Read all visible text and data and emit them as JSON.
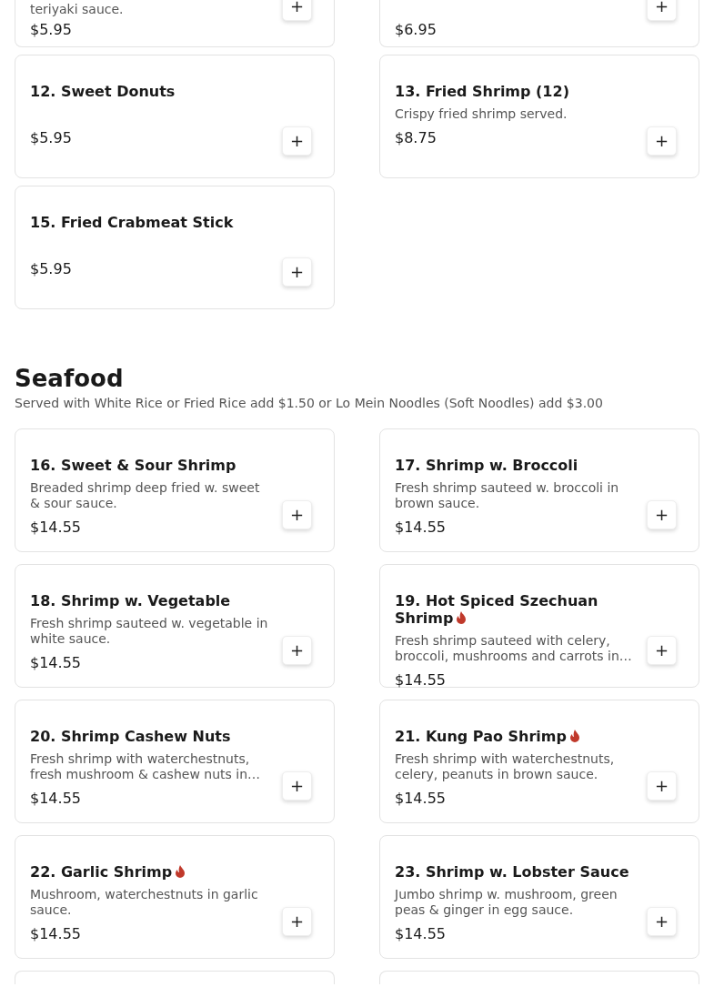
{
  "top_cut_items": [
    {
      "description": "teriyaki sauce.",
      "price": "$5.95",
      "add_label": "+"
    },
    {
      "price": "$6.95",
      "add_label": "+"
    }
  ],
  "items": [
    {
      "title": "12. Sweet Donuts",
      "spicy": false,
      "price": "$5.95",
      "add_label": "+"
    },
    {
      "title": "13. Fried Shrimp (12)",
      "spicy": false,
      "description": "Crispy fried shrimp served.",
      "price": "$8.75",
      "add_label": "+"
    },
    {
      "title": "15. Fried Crabmeat Stick",
      "spicy": false,
      "price": "$5.95",
      "add_label": "+"
    }
  ],
  "section": {
    "title": "Seafood",
    "subtitle": "Served with White Rice or Fried Rice add $1.50 or Lo Mein Noodles (Soft Noodles) add $3.00",
    "items": [
      {
        "title": "16. Sweet & Sour Shrimp",
        "spicy": false,
        "description": "Breaded shrimp deep fried w. sweet & sour sauce.",
        "price": "$14.55",
        "add_label": "+"
      },
      {
        "title": "17. Shrimp w. Broccoli",
        "spicy": false,
        "description": "Fresh shrimp sauteed w. broccoli in brown sauce.",
        "price": "$14.55",
        "add_label": "+"
      },
      {
        "title": "18. Shrimp w. Vegetable",
        "spicy": false,
        "description": "Fresh shrimp sauteed w. vegetable in white sauce.",
        "price": "$14.55",
        "add_label": "+"
      },
      {
        "title": "19. Hot Spiced Szechuan Shrimp",
        "spicy": true,
        "description": "Fresh shrimp sauteed with celery, broccoli, mushrooms and carrots in…",
        "price": "$14.55",
        "add_label": "+"
      },
      {
        "title": "20. Shrimp Cashew Nuts",
        "spicy": false,
        "description": "Fresh shrimp with waterchestnuts, fresh mushroom & cashew nuts in…",
        "price": "$14.55",
        "add_label": "+"
      },
      {
        "title": "21. Kung Pao Shrimp",
        "spicy": true,
        "description": "Fresh shrimp with waterchestnuts, celery, peanuts in brown sauce.",
        "price": "$14.55",
        "add_label": "+"
      },
      {
        "title": "22. Garlic Shrimp",
        "spicy": true,
        "description": "Mushroom, waterchestnuts in garlic sauce.",
        "price": "$14.55",
        "add_label": "+"
      },
      {
        "title": "23. Shrimp w. Lobster Sauce",
        "spicy": false,
        "description": "Jumbo shrimp w. mushroom, green peas & ginger in egg sauce.",
        "price": "$14.55",
        "add_label": "+"
      }
    ],
    "bottom_cut_cards": [
      {
        "kind": "card"
      },
      {
        "kind": "card"
      }
    ]
  }
}
